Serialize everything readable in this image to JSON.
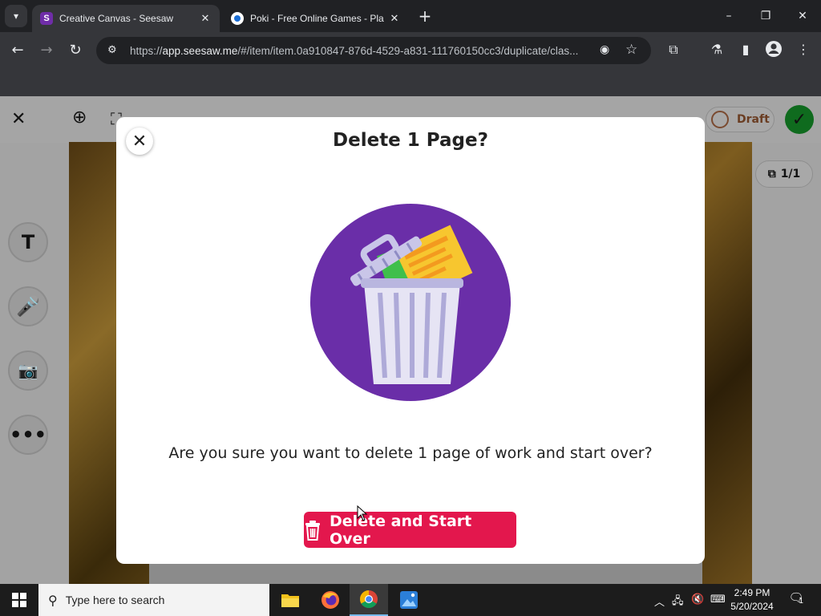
{
  "browser": {
    "tabs": [
      {
        "title": "Creative Canvas - Seesaw",
        "favicon": "seesaw-icon",
        "active": true
      },
      {
        "title": "Poki - Free Online Games - Pla",
        "favicon": "poki-icon",
        "active": false
      }
    ],
    "url_prefix": "https://",
    "url_host": "app.seesaw.me",
    "url_rest": "/#/item/item.0a910847-876d-4529-a831-111760150cc3/duplicate/clas..."
  },
  "app": {
    "draft_label": "Draft",
    "page_count": "1/1",
    "tools": [
      "text-tool",
      "microphone-tool",
      "camera-tool",
      "more-tool"
    ],
    "text_tool_label": "T"
  },
  "dialog": {
    "title": "Delete 1 Page?",
    "message": "Are you sure you want to delete 1 page of work and start over?",
    "confirm_label": "Delete and Start Over",
    "accent": "#e3174d",
    "illustration_bg": "#6a2ea8"
  },
  "taskbar": {
    "search_placeholder": "Type here to search",
    "time": "2:49 PM",
    "date": "5/20/2024",
    "notification_count": "1"
  }
}
